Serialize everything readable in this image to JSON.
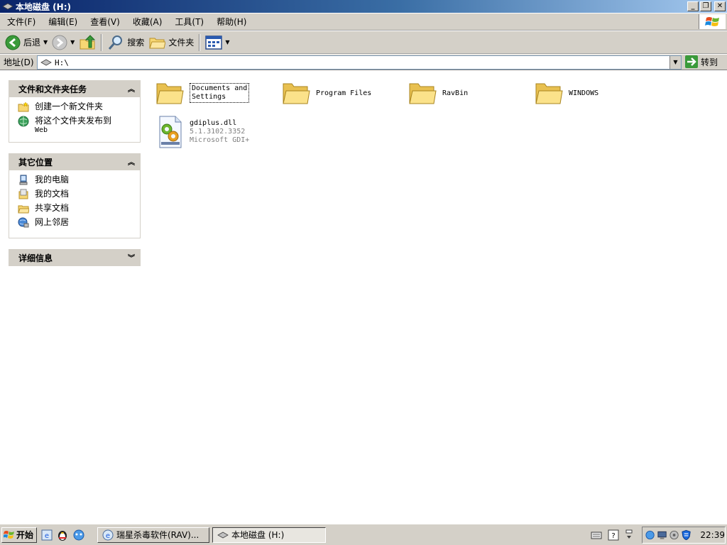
{
  "window": {
    "title": "本地磁盘  (H:)",
    "buttons": {
      "minimize": "_",
      "maximize": "❐",
      "close": "✕"
    }
  },
  "menu": [
    "文件(F)",
    "编辑(E)",
    "查看(V)",
    "收藏(A)",
    "工具(T)",
    "帮助(H)"
  ],
  "toolbar": {
    "back_label": "后退",
    "search_label": "搜索",
    "folders_label": "文件夹"
  },
  "address": {
    "label": "地址(D)",
    "value": "H:\\",
    "go_label": "转到"
  },
  "left_pane": {
    "tasks": {
      "title": "文件和文件夹任务",
      "items": [
        {
          "label": "创建一个新文件夹",
          "icon": "new-folder-icon"
        },
        {
          "label": "将这个文件夹发布到",
          "sub": "Web",
          "icon": "publish-web-icon"
        }
      ]
    },
    "places": {
      "title": "其它位置",
      "items": [
        {
          "label": "我的电脑",
          "icon": "my-computer-icon"
        },
        {
          "label": "我的文档",
          "icon": "my-documents-icon"
        },
        {
          "label": "共享文档",
          "icon": "shared-documents-icon"
        },
        {
          "label": "网上邻居",
          "icon": "network-places-icon"
        }
      ]
    },
    "details": {
      "title": "详细信息"
    }
  },
  "content": {
    "folders": [
      {
        "name_line1": "Documents and",
        "name_line2": "Settings"
      },
      {
        "name": "Program Files"
      },
      {
        "name": "RavBin"
      },
      {
        "name": "WINDOWS"
      }
    ],
    "files": [
      {
        "name": "gdiplus.dll",
        "version": "5.1.3102.3352",
        "description": "Microsoft GDI+"
      }
    ]
  },
  "taskbar": {
    "start_label": "开始",
    "tasks": [
      {
        "label": "瑞星杀毒软件(RAV)..."
      },
      {
        "label": "本地磁盘  (H:)"
      }
    ],
    "clock": "22:39"
  },
  "colors": {
    "title_gradient_start": "#0a246a",
    "title_gradient_end": "#a6caf0",
    "chrome": "#d4d0c8",
    "folder_yellow": "#f7d774"
  }
}
